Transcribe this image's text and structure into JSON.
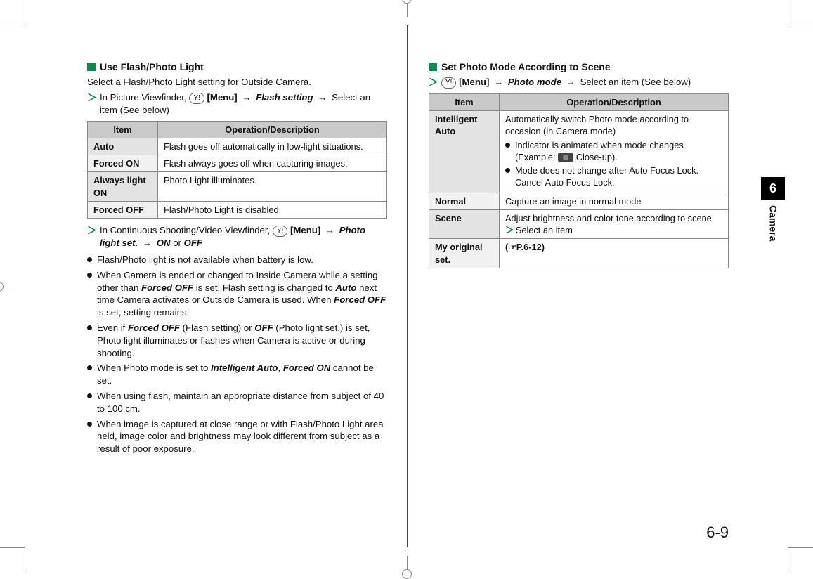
{
  "thumb": {
    "number": "6",
    "label": "Camera"
  },
  "page_number": "6-9",
  "left": {
    "title": "Use Flash/Photo Light",
    "intro": "Select a Flash/Photo Light setting for Outside Camera.",
    "step1_prefix": "In Picture Viewfinder, ",
    "step1_btn": "Y!",
    "step1_menu": "[Menu]",
    "step1_flash": "Flash setting",
    "step1_suffix": "Select an item (See below)",
    "table_headers": {
      "item": "Item",
      "desc": "Operation/Description"
    },
    "rows": [
      {
        "item": "Auto",
        "desc": "Flash goes off automatically in low-light situations."
      },
      {
        "item": "Forced ON",
        "desc": "Flash always goes off when capturing images."
      },
      {
        "item": "Always light ON",
        "desc": "Photo Light illuminates."
      },
      {
        "item": "Forced OFF",
        "desc": "Flash/Photo Light is disabled."
      }
    ],
    "step2_prefix": "In Continuous Shooting/Video Viewfinder, ",
    "step2_btn": "Y!",
    "step2_menu": "[Menu]",
    "step2_set": "Photo light set.",
    "step2_on": "ON",
    "step2_or": " or ",
    "step2_off": "OFF",
    "notes": [
      "Flash/Photo light is not available when battery is low.",
      "When Camera is ended or changed to Inside Camera while a setting other than <bi>Forced OFF</bi> is set, Flash setting is changed to <bi>Auto</bi> next time Camera activates or Outside Camera is used. When <bi>Forced OFF</bi> is set, setting remains.",
      "Even if <bi>Forced OFF</bi> (Flash setting) or <bi>OFF</bi> (Photo light set.) is set, Photo light illuminates or flashes when Camera is active or during shooting.",
      "When Photo mode is set to <bi>Intelligent Auto</bi>, <bi>Forced ON</bi> cannot be set.",
      "When using flash, maintain an appropriate distance from subject of 40 to 100 cm.",
      "When image is captured at close range or with Flash/Photo Light area held, image color and brightness may look different from subject as a result of poor exposure."
    ]
  },
  "right": {
    "title": "Set Photo Mode According to Scene",
    "step_btn": "Y!",
    "step_menu": "[Menu]",
    "step_mode": "Photo mode",
    "step_suffix": "Select an item (See below)",
    "table_headers": {
      "item": "Item",
      "desc": "Operation/Description"
    },
    "rows": {
      "r1_item": "Intelligent Auto",
      "r1_desc_main": "Automatically switch Photo mode according to occasion (in Camera mode)",
      "r1_b1_a": "Indicator is animated when mode changes (Example: ",
      "r1_b1_b": " Close-up).",
      "r1_b2": "Mode does not change after Auto Focus Lock. Cancel Auto Focus Lock.",
      "r2_item": "Normal",
      "r2_desc": "Capture an image in normal mode",
      "r3_item": "Scene",
      "r3_desc_a": "Adjust brightness and color tone according to scene",
      "r3_desc_b": "Select an item",
      "r4_item": "My original set.",
      "r4_desc": "(☞P.6-12)"
    }
  }
}
